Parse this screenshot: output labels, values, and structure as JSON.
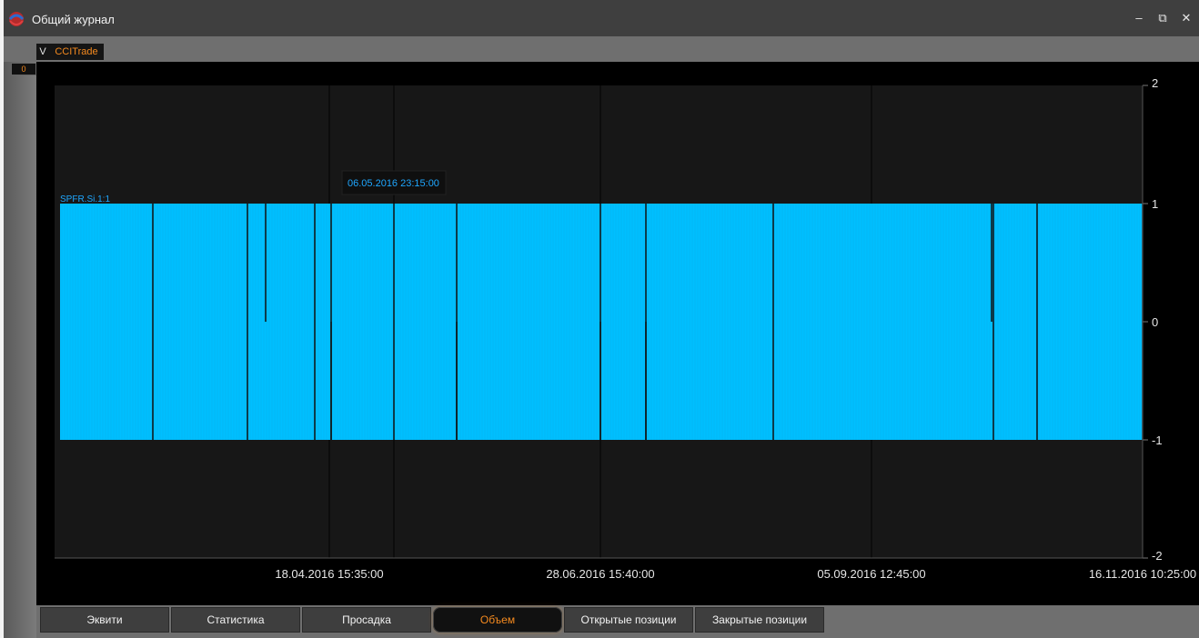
{
  "window": {
    "title": "Общий журнал",
    "min_label": "–",
    "restore_label": "⧉",
    "close_label": "✕"
  },
  "tabs": [
    {
      "label": "V"
    },
    {
      "label": "CCITrade"
    }
  ],
  "side_badge": "0",
  "bottom_tabs": [
    {
      "label": "Эквити",
      "active": false
    },
    {
      "label": "Статистика",
      "active": false
    },
    {
      "label": "Просадка",
      "active": false
    },
    {
      "label": "Объем",
      "active": true
    },
    {
      "label": "Открытые позиции",
      "active": false
    },
    {
      "label": "Закрытые позиции",
      "active": false
    }
  ],
  "chart": {
    "tooltip": "06.05.2016 23:15:00",
    "series_label": "SPFR.Si.1:1",
    "colors": {
      "bar": "#00bfff",
      "accent": "#f58a1f"
    }
  },
  "chart_data": {
    "type": "bar",
    "ylim": [
      -2,
      2
    ],
    "y_ticks": [
      "2",
      "1",
      "0",
      "-1",
      "-2"
    ],
    "x_ticks": [
      "18.04.2016 15:35:00",
      "28.06.2016 15:40:00",
      "05.09.2016 12:45:00",
      "16.11.2016 10:25:00"
    ],
    "series": [
      {
        "name": "SPFR.Si.1:1",
        "values_range": [
          -1,
          1
        ]
      }
    ]
  }
}
